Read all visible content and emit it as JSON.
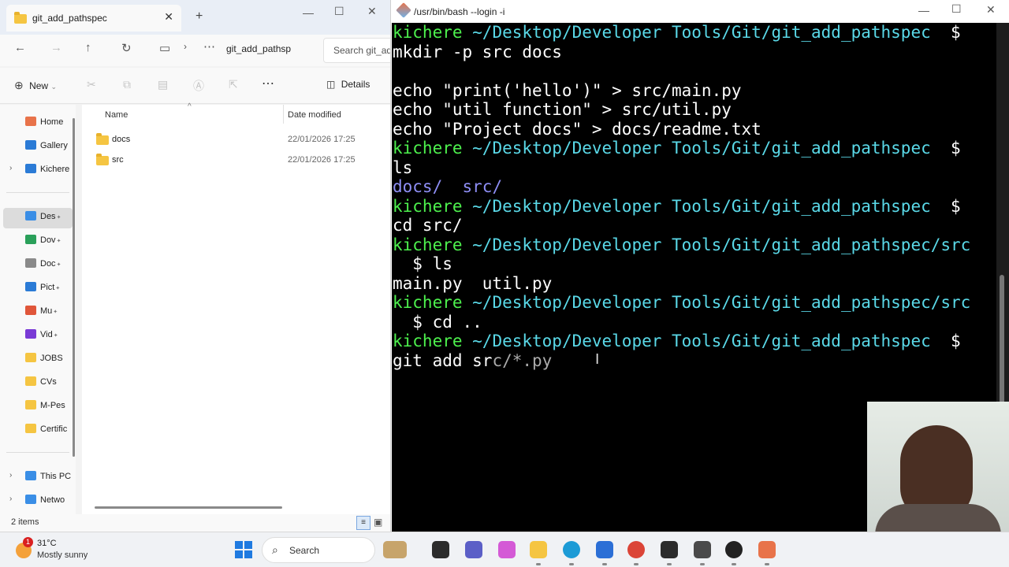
{
  "explorer": {
    "tab_title": "git_add_pathspec",
    "new_tab": "+",
    "close_tab": "✕",
    "window_controls": {
      "minimize": "—",
      "maximize": "☐",
      "close": "✕"
    },
    "address_crumb": "git_add_pathsp",
    "search_placeholder": "Search git_ad",
    "new_label": "New",
    "details_label": "Details",
    "nav_items": [
      {
        "label": "Home",
        "icon": "home-icon",
        "color": "#e8734a"
      },
      {
        "label": "Gallery",
        "icon": "gallery-icon",
        "color": "#2b7bd6"
      },
      {
        "label": "Kichere",
        "icon": "cloud-icon",
        "color": "#2b7bd6"
      },
      {
        "label": "Des",
        "icon": "desktop-icon",
        "color": "#3a8ee6"
      },
      {
        "label": "Dov",
        "icon": "download-icon",
        "color": "#2aa05a"
      },
      {
        "label": "Doc",
        "icon": "document-icon",
        "color": "#8a8a8a"
      },
      {
        "label": "Pict",
        "icon": "pictures-icon",
        "color": "#2b7bd6"
      },
      {
        "label": "Mu",
        "icon": "music-icon",
        "color": "#e0563a"
      },
      {
        "label": "Vid",
        "icon": "video-icon",
        "color": "#7a3bd6"
      },
      {
        "label": "JOBS",
        "icon": "folder-icon",
        "color": "#f5c542"
      },
      {
        "label": "CVs",
        "icon": "folder-icon",
        "color": "#f5c542"
      },
      {
        "label": "M-Pes",
        "icon": "folder-icon",
        "color": "#f5c542"
      },
      {
        "label": "Certific",
        "icon": "folder-icon",
        "color": "#f5c542"
      },
      {
        "label": "This PC",
        "icon": "pc-icon",
        "color": "#3a8ee6"
      },
      {
        "label": "Netwo",
        "icon": "network-icon",
        "color": "#3a8ee6"
      }
    ],
    "columns": {
      "name": "Name",
      "date_modified": "Date modified"
    },
    "files": [
      {
        "name": "docs",
        "date": "22/01/2026 17:25"
      },
      {
        "name": "src",
        "date": "22/01/2026 17:25"
      }
    ],
    "status": "2 items"
  },
  "terminal": {
    "title": "/usr/bin/bash --login -i",
    "window_controls": {
      "minimize": "—",
      "maximize": "☐",
      "close": "✕"
    },
    "lines": [
      [
        {
          "t": "kichere ",
          "c": "g"
        },
        {
          "t": "~/Desktop/Developer Tools/Git/git_add_pathspec",
          "c": "c"
        },
        {
          "t": "  $",
          "c": ""
        }
      ],
      [
        {
          "t": "mkdir -p src docs",
          "c": ""
        }
      ],
      [
        {
          "t": "",
          "c": ""
        }
      ],
      [
        {
          "t": "echo \"print('hello')\" > src/main.py",
          "c": ""
        }
      ],
      [
        {
          "t": "echo \"util function\" > src/util.py",
          "c": ""
        }
      ],
      [
        {
          "t": "echo \"Project docs\" > docs/readme.txt",
          "c": ""
        }
      ],
      [
        {
          "t": "kichere ",
          "c": "g"
        },
        {
          "t": "~/Desktop/Developer Tools/Git/git_add_pathspec",
          "c": "c"
        },
        {
          "t": "  $",
          "c": ""
        }
      ],
      [
        {
          "t": "ls",
          "c": ""
        }
      ],
      [
        {
          "t": "docs/",
          "c": "b"
        },
        {
          "t": "  ",
          "c": ""
        },
        {
          "t": "src/",
          "c": "b"
        }
      ],
      [
        {
          "t": "kichere ",
          "c": "g"
        },
        {
          "t": "~/Desktop/Developer Tools/Git/git_add_pathspec",
          "c": "c"
        },
        {
          "t": "  $",
          "c": ""
        }
      ],
      [
        {
          "t": "cd src/",
          "c": ""
        }
      ],
      [
        {
          "t": "kichere ",
          "c": "g"
        },
        {
          "t": "~/Desktop/Developer Tools/Git/git_add_pathspec/src",
          "c": "c"
        }
      ],
      [
        {
          "t": "  $ ls",
          "c": ""
        }
      ],
      [
        {
          "t": "main.py  util.py",
          "c": ""
        }
      ],
      [
        {
          "t": "kichere ",
          "c": "g"
        },
        {
          "t": "~/Desktop/Developer Tools/Git/git_add_pathspec/src",
          "c": "c"
        }
      ],
      [
        {
          "t": "  $ cd ..",
          "c": ""
        }
      ],
      [
        {
          "t": "kichere ",
          "c": "g"
        },
        {
          "t": "~/Desktop/Developer Tools/Git/git_add_pathspec",
          "c": "c"
        },
        {
          "t": "  $",
          "c": ""
        }
      ],
      [
        {
          "t": "git add sr",
          "c": ""
        },
        {
          "t": "c/*.py",
          "c": "gr"
        }
      ]
    ]
  },
  "taskbar": {
    "weather_temp": "31°C",
    "weather_desc": "Mostly sunny",
    "weather_badge": "1",
    "search_label": "Search",
    "apps": [
      {
        "name": "start-icon",
        "color": "#1f7ae0"
      },
      {
        "name": "widget-icon",
        "color": "#c7a46b"
      },
      {
        "name": "task-view-icon",
        "color": "#2c2c2c"
      },
      {
        "name": "teams-icon",
        "color": "#5b5fc7"
      },
      {
        "name": "copilot-icon",
        "color": "#d45ad6"
      },
      {
        "name": "file-explorer-icon",
        "color": "#f5c542"
      },
      {
        "name": "edge-icon",
        "color": "#1c9bd6"
      },
      {
        "name": "store-icon",
        "color": "#2b6fd6"
      },
      {
        "name": "chrome-icon",
        "color": "#db4437"
      },
      {
        "name": "terminal-icon",
        "color": "#2c2c2c"
      },
      {
        "name": "camera-icon",
        "color": "#4a4a4a"
      },
      {
        "name": "record-icon",
        "color": "#222"
      },
      {
        "name": "git-icon",
        "color": "#e8734a"
      }
    ]
  }
}
